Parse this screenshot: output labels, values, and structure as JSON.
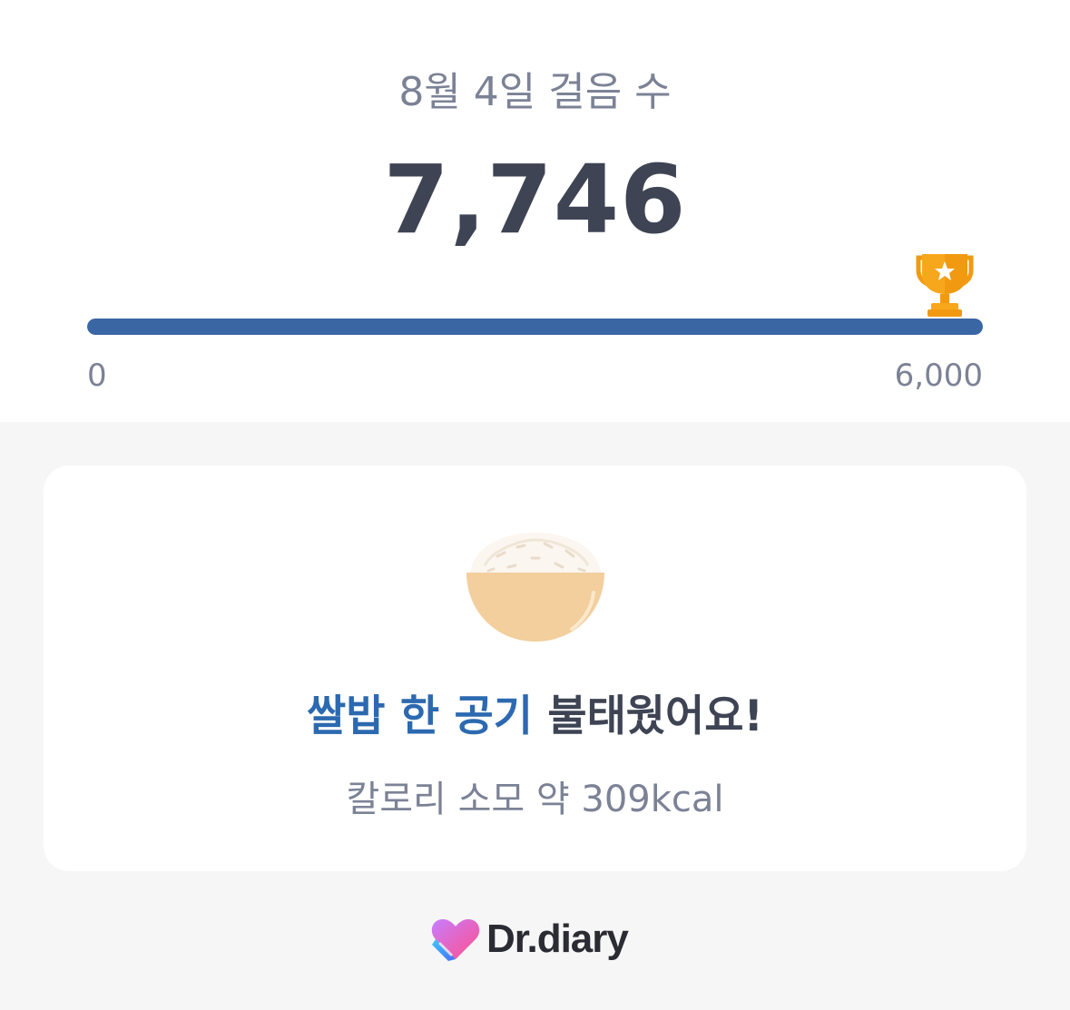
{
  "summary": {
    "date_label": "8월 4일 걸음 수",
    "steps": "7,746",
    "progress": {
      "value": 7746,
      "goal": 6000,
      "fill_fraction": 1.0,
      "min_label": "0",
      "max_label": "6,000",
      "bar_color": "#3b66a4",
      "goal_icon": "trophy-icon"
    }
  },
  "card": {
    "illustration": "rice-bowl-icon",
    "headline_accent": "쌀밥 한 공기",
    "headline_rest": " 불태웠어요!",
    "calorie_text": "칼로리 소모 약 309kcal",
    "accent_color": "#2c69b0"
  },
  "footer": {
    "brand_name": "Dr.diary",
    "brand_icon": "heart-logo-icon"
  }
}
